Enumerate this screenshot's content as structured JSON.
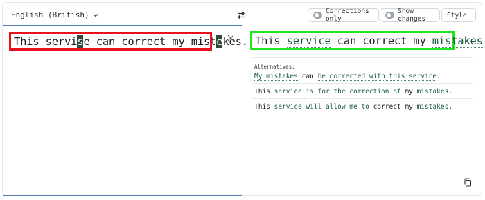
{
  "header": {
    "language": "English (British)",
    "corrections_only_label": "Corrections only",
    "show_changes_label": "Show changes",
    "style_label": "Style"
  },
  "source": {
    "part1": "This servi",
    "hl1": "s",
    "part2": "e can correct my mist",
    "hl2": "e",
    "part3": "kes."
  },
  "output": {
    "w1": "This",
    "w2": "service",
    "w3": "can correct my",
    "w4": "mistakes",
    "w5": "."
  },
  "alternatives": {
    "label": "Alternatives:",
    "items": [
      {
        "a": "My mistakes",
        "b": "can",
        "c": "be corrected with this service",
        "d": "."
      },
      {
        "a": "This",
        "b": "service is for the correction of",
        "c": "my",
        "d": "mistakes",
        "e": "."
      },
      {
        "a": "This",
        "b": "service will allow me to",
        "c": "correct my",
        "d": "mistakes",
        "e": "."
      }
    ]
  },
  "icons": {
    "language_chevron": "chevron-down-icon",
    "swap": "swap-arrows-icon",
    "close": "close-icon",
    "style_chevron": "chevron-down-icon",
    "copy": "copy-icon"
  },
  "colors": {
    "source_highlight_box": "#e8121b",
    "output_highlight_box": "#1ee61e",
    "changed_text": "#1c5a3e",
    "input_border": "#4e7fb8"
  }
}
